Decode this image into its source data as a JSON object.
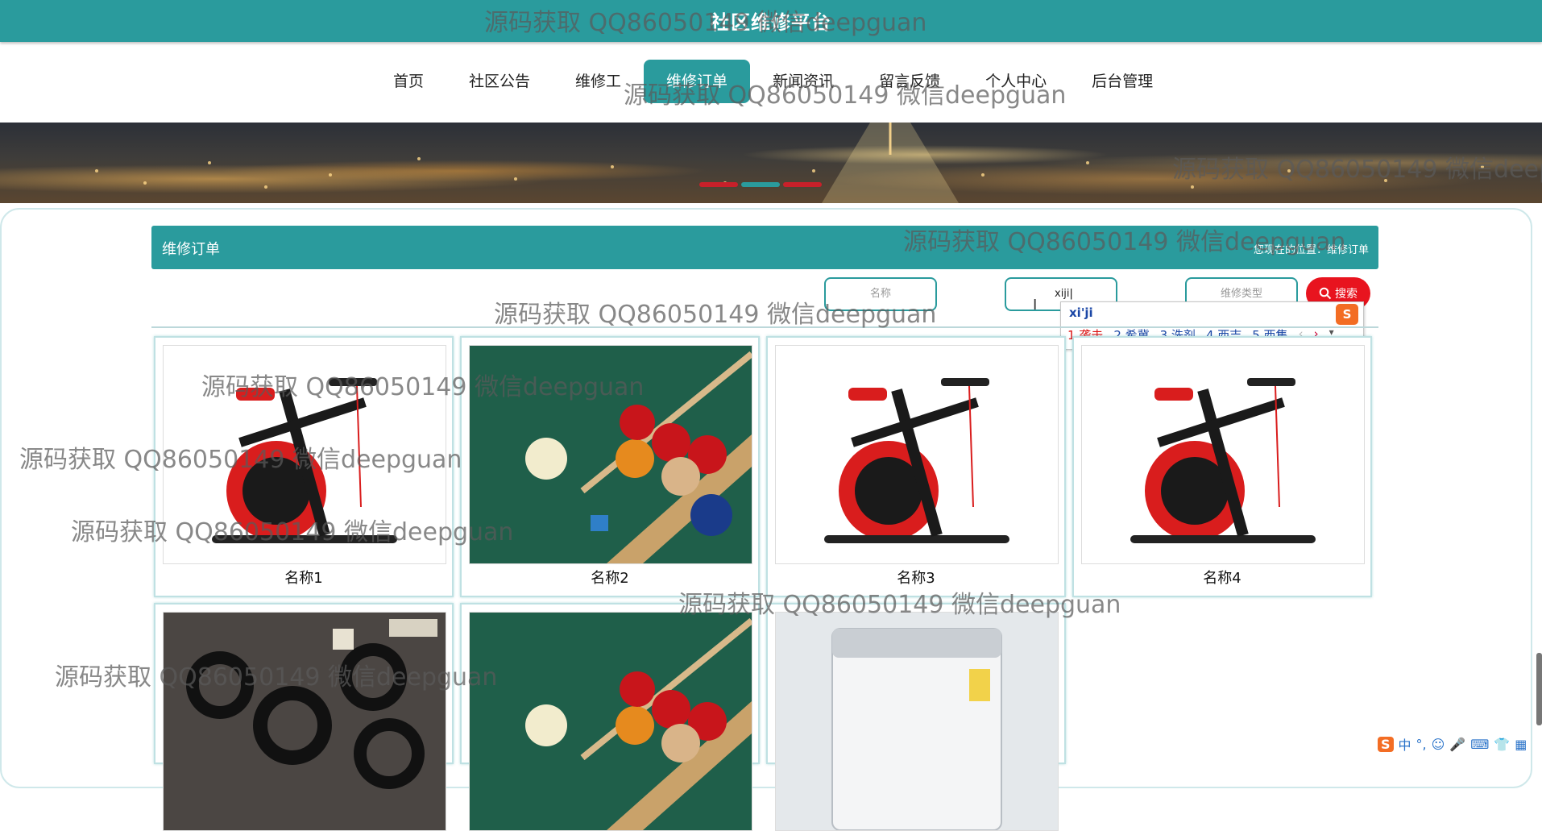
{
  "site": {
    "title": "社区维修平台"
  },
  "nav": {
    "items": [
      {
        "label": "首页"
      },
      {
        "label": "社区公告"
      },
      {
        "label": "维修工"
      },
      {
        "label": "维修订单"
      },
      {
        "label": "新闻资讯"
      },
      {
        "label": "留言反馈"
      },
      {
        "label": "个人中心"
      },
      {
        "label": "后台管理"
      }
    ],
    "active_index": 3
  },
  "section": {
    "title": "维修订单",
    "breadcrumb": "您现在的位置：维修订单"
  },
  "filters": {
    "name_placeholder": "名称",
    "middle_value": "xiji",
    "type_placeholder": "维修类型",
    "search_label": "搜索"
  },
  "ime": {
    "pinyin": "xi'ji",
    "candidates": [
      "1.袭击",
      "2.希冀",
      "3.洗剂",
      "4.西吉",
      "5.西集"
    ]
  },
  "products": [
    {
      "name": "名称1",
      "image": "spin-bike"
    },
    {
      "name": "名称2",
      "image": "billiards"
    },
    {
      "name": "名称3",
      "image": "spin-bike"
    },
    {
      "name": "名称4",
      "image": "spin-bike"
    },
    {
      "name": "",
      "image": "tire-wall"
    },
    {
      "name": "",
      "image": "billiards"
    },
    {
      "name": "",
      "image": "washing-machine"
    }
  ],
  "watermark": {
    "text": "源码获取 QQ86050149 微信deepguan"
  },
  "tray": {
    "items": [
      "S",
      "中",
      "°,",
      "☺",
      "🎤",
      "⌨",
      "👕",
      "▦"
    ]
  },
  "colors": {
    "primary": "#2a9b9d",
    "search": "#e8141f"
  }
}
